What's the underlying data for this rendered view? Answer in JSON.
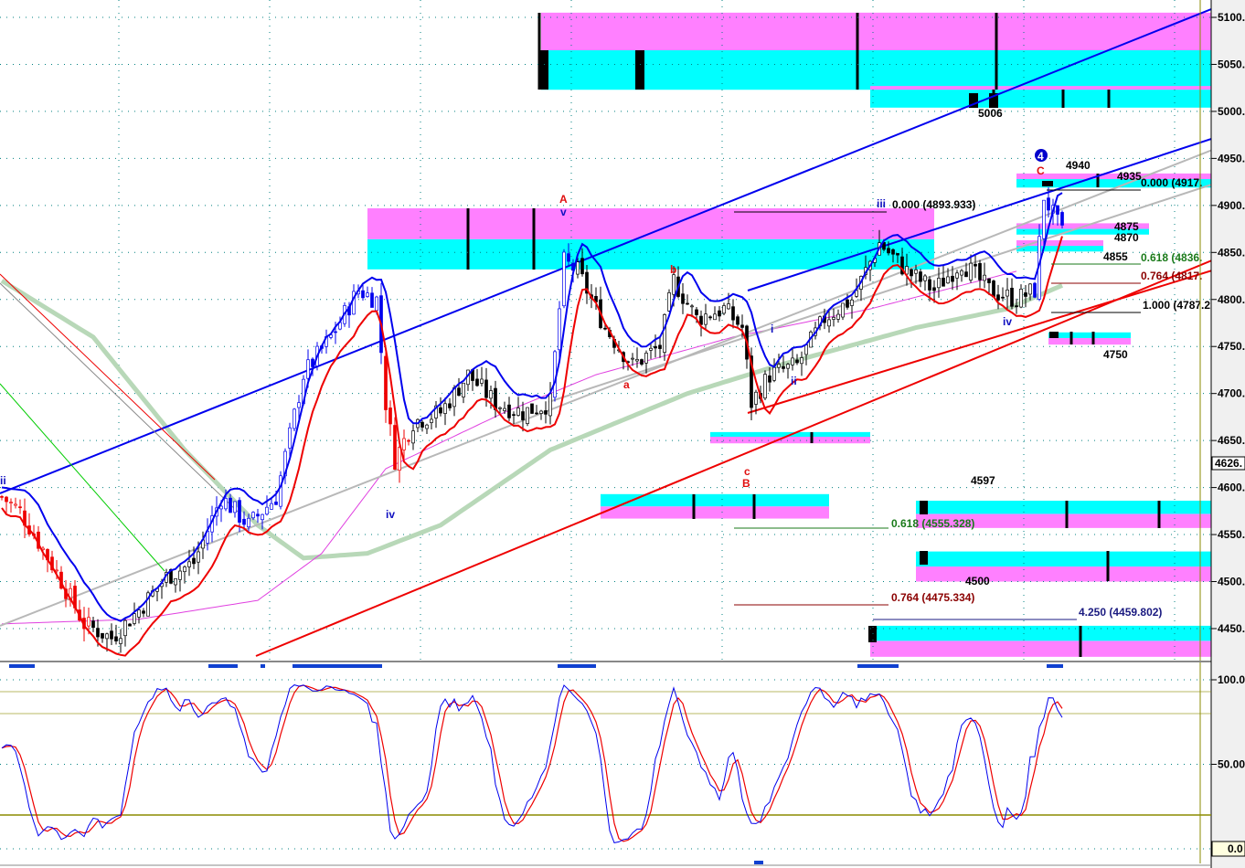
{
  "chart_data": {
    "type": "candlestick",
    "instrument_last_price": "4626.",
    "price_axis": {
      "ticks": [
        5100,
        5050,
        5000,
        4950,
        4900,
        4850,
        4800,
        4750,
        4700,
        4650,
        4600,
        4550,
        4500,
        4450
      ],
      "tick_labels": [
        "5100.",
        "5050.",
        "5000.",
        "4950.",
        "4900.",
        "4850.",
        "4800.",
        "4750.",
        "4700.",
        "4650.",
        "4600.",
        "4550.",
        "4500.",
        "4450."
      ],
      "range": [
        4420,
        5110
      ]
    },
    "oscillator_axis": {
      "tick_labels": [
        "100.0",
        "50.00",
        "0.0"
      ],
      "ticks": [
        100,
        50,
        0
      ],
      "levels": [
        93,
        80,
        20
      ]
    },
    "price_path": [
      [
        0,
        4590
      ],
      [
        4,
        4575
      ],
      [
        12,
        4510
      ],
      [
        18,
        4455
      ],
      [
        24,
        4440
      ],
      [
        30,
        4470
      ],
      [
        36,
        4505
      ],
      [
        42,
        4520
      ],
      [
        48,
        4590
      ],
      [
        54,
        4560
      ],
      [
        60,
        4590
      ],
      [
        66,
        4720
      ],
      [
        72,
        4760
      ],
      [
        78,
        4810
      ],
      [
        82,
        4800
      ],
      [
        84,
        4690
      ],
      [
        86,
        4630
      ],
      [
        90,
        4670
      ],
      [
        96,
        4680
      ],
      [
        102,
        4720
      ],
      [
        108,
        4690
      ],
      [
        114,
        4680
      ],
      [
        120,
        4690
      ],
      [
        123,
        4840
      ],
      [
        126,
        4830
      ],
      [
        132,
        4770
      ],
      [
        138,
        4730
      ],
      [
        144,
        4750
      ],
      [
        147,
        4820
      ],
      [
        152,
        4780
      ],
      [
        158,
        4790
      ],
      [
        162,
        4770
      ],
      [
        164,
        4690
      ],
      [
        168,
        4720
      ],
      [
        174,
        4730
      ],
      [
        180,
        4780
      ],
      [
        186,
        4800
      ],
      [
        192,
        4860
      ],
      [
        198,
        4830
      ],
      [
        204,
        4810
      ],
      [
        210,
        4840
      ],
      [
        216,
        4810
      ],
      [
        222,
        4800
      ],
      [
        226,
        4810
      ],
      [
        228,
        4910
      ],
      [
        232,
        4870
      ]
    ],
    "moving_average_green": [
      [
        0,
        4820
      ],
      [
        20,
        4760
      ],
      [
        40,
        4640
      ],
      [
        56,
        4560
      ],
      [
        66,
        4525
      ],
      [
        80,
        4530
      ],
      [
        96,
        4560
      ],
      [
        120,
        4640
      ],
      [
        150,
        4700
      ],
      [
        170,
        4730
      ],
      [
        200,
        4770
      ],
      [
        220,
        4790
      ],
      [
        232,
        4815
      ]
    ],
    "moving_average_magenta": [
      [
        0,
        4455
      ],
      [
        30,
        4460
      ],
      [
        56,
        4480
      ],
      [
        70,
        4530
      ],
      [
        84,
        4620
      ],
      [
        110,
        4680
      ],
      [
        130,
        4720
      ],
      [
        160,
        4760
      ],
      [
        190,
        4790
      ],
      [
        222,
        4830
      ]
    ],
    "zones": [
      {
        "t": [
          118,
          265
        ],
        "pink": [
          5065,
          5105
        ],
        "cyan": [
          5023,
          5065
        ]
      },
      {
        "t": [
          190,
          265
        ],
        "pink": [
          5023,
          5027
        ],
        "cyan": [
          5004,
          5023
        ]
      },
      {
        "t": [
          80,
          204
        ],
        "pink": [
          4864,
          4897
        ],
        "cyan": [
          4832,
          4864
        ]
      },
      {
        "t": [
          222,
          265
        ],
        "pink": [
          4928,
          4934
        ],
        "cyan": [
          4919,
          4928
        ]
      },
      {
        "t": [
          222,
          251
        ],
        "pink": [
          4875,
          4881
        ],
        "cyan": [
          4869,
          4875
        ]
      },
      {
        "t": [
          222,
          241
        ],
        "pink": [
          4857,
          4863
        ],
        "cyan": [
          4851,
          4857
        ]
      },
      {
        "t": [
          229,
          247
        ],
        "cyan": [
          4759,
          4765
        ],
        "pink": [
          4752,
          4759
        ]
      },
      {
        "t": [
          155,
          190
        ],
        "cyan": [
          4654,
          4659
        ],
        "pink": [
          4647,
          4654
        ]
      },
      {
        "t": [
          131,
          181
        ],
        "cyan": [
          4580,
          4593
        ],
        "pink": [
          4567,
          4580
        ]
      },
      {
        "t": [
          200,
          265
        ],
        "cyan": [
          4572,
          4586
        ],
        "pink": [
          4557,
          4572
        ]
      },
      {
        "t": [
          200,
          265
        ],
        "cyan": [
          4516,
          4532
        ],
        "pink": [
          4500,
          4516
        ]
      },
      {
        "t": [
          190,
          265
        ],
        "cyan": [
          4437,
          4453
        ],
        "pink": [
          4420,
          4437
        ]
      }
    ],
    "wave_labels": [
      {
        "text": "ii",
        "color": "#1010c0"
      },
      {
        "text": "iv",
        "color": "#1010c0"
      },
      {
        "text": "A",
        "color": "#e01010"
      },
      {
        "text": "v",
        "color": "#1010c0"
      },
      {
        "text": "a",
        "color": "#e01010"
      },
      {
        "text": "b",
        "color": "#e01010"
      },
      {
        "text": "c",
        "color": "#e01010"
      },
      {
        "text": "B",
        "color": "#e01010"
      },
      {
        "text": "i",
        "color": "#1010c0"
      },
      {
        "text": "ii",
        "color": "#1010c0"
      },
      {
        "text": "iii",
        "color": "#1010c0"
      },
      {
        "text": "iv",
        "color": "#1010c0"
      },
      {
        "text": "C",
        "color": "#e01010"
      },
      {
        "text": "4",
        "color": "#ffffff"
      }
    ],
    "price_labels": [
      "5006",
      "4597",
      "4500",
      "4750",
      "4855",
      "4875",
      "4870",
      "4940",
      "4935"
    ],
    "fib_levels": [
      {
        "label": "0.000 (4893.933)",
        "color": "#000000"
      },
      {
        "label": "0.000 (4917.",
        "color": "#000000"
      },
      {
        "label": "0.618 (4836.",
        "color": "#1a7a1a"
      },
      {
        "label": "0.764 (4817.",
        "color": "#8b0000"
      },
      {
        "label": "1.000 (4787.2",
        "color": "#000000"
      },
      {
        "label": "0.618 (4555.328)",
        "color": "#1a7a1a"
      },
      {
        "label": "0.764 (4475.334)",
        "color": "#8b0000"
      },
      {
        "label": "4.250 (4459.802)",
        "color": "#1a1a80"
      }
    ]
  },
  "colors": {
    "pink": "#ff80ff",
    "cyan": "#00ffff",
    "blue": "#0000ee",
    "red": "#ee0000",
    "green": "#b8d8b8",
    "magenta": "#e040e0",
    "grid": "#008080",
    "olive": "#8b8b00"
  }
}
